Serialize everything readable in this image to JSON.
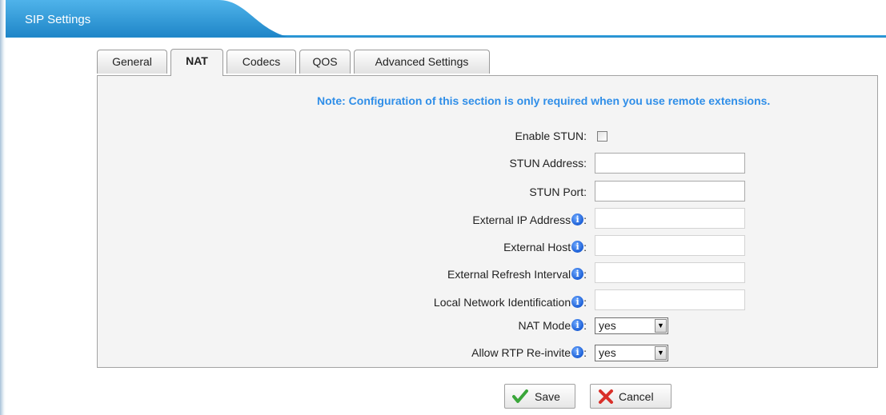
{
  "header": {
    "title": "SIP Settings"
  },
  "tabs": [
    {
      "label": "General"
    },
    {
      "label": "NAT"
    },
    {
      "label": "Codecs"
    },
    {
      "label": "QOS"
    },
    {
      "label": "Advanced Settings"
    }
  ],
  "active_tab": "NAT",
  "note": "Note: Configuration of this section is only required when you use remote extensions.",
  "fields": {
    "enable_stun": {
      "label": "Enable STUN:",
      "checked": false
    },
    "stun_address": {
      "label": "STUN Address:",
      "value": ""
    },
    "stun_port": {
      "label": "STUN Port:",
      "value": ""
    },
    "external_ip": {
      "label": "External IP Address",
      "value": ""
    },
    "external_host": {
      "label": "External Host",
      "value": ""
    },
    "external_refresh": {
      "label": "External Refresh Interval",
      "value": ""
    },
    "local_network": {
      "label": "Local Network Identification",
      "value": ""
    },
    "nat_mode": {
      "label": "NAT Mode",
      "value": "yes"
    },
    "allow_rtp_reinvite": {
      "label": "Allow RTP Re-invite",
      "value": "yes"
    }
  },
  "label_suffix": ":",
  "info_glyph": "i",
  "dropdown_glyph": "▼",
  "buttons": {
    "save": "Save",
    "cancel": "Cancel"
  },
  "icons": {
    "info": "info-icon",
    "save": "checkmark-icon",
    "cancel": "x-icon",
    "dropdown": "dropdown-arrow-icon"
  },
  "colors": {
    "header_blue": "#1f86c8",
    "note_blue": "#2f8ee8",
    "panel_bg": "#f4f4f4",
    "save_green": "#3aa63a",
    "cancel_red": "#d9302a"
  }
}
